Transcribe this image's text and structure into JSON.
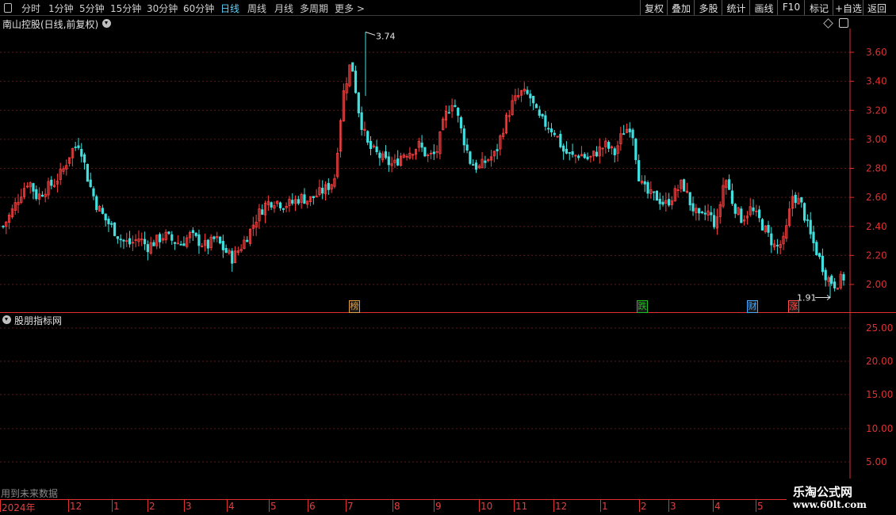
{
  "toolbar": {
    "tabs": [
      "分时",
      "1分钟",
      "5分钟",
      "15分钟",
      "30分钟",
      "60分钟",
      "日线",
      "周线",
      "月线",
      "多周期",
      "更多 >"
    ],
    "active_tab": "日线",
    "right_buttons": [
      "复权",
      "叠加",
      "多股",
      "统计",
      "画线",
      "F10",
      "标记",
      "+自选",
      "返回"
    ]
  },
  "chart": {
    "title": "南山控股(日线,前复权)",
    "high_label": "3.74",
    "low_label": "1.91",
    "tags": [
      {
        "text": "榜",
        "color": "#e0a040"
      },
      {
        "text": "跌",
        "color": "#20c020"
      },
      {
        "text": "财",
        "color": "#4aa8ff"
      },
      {
        "text": "涨",
        "color": "#ff5050"
      }
    ]
  },
  "sub_panel": {
    "title": "股朋指标网",
    "yticks": [
      "25.00",
      "20.00",
      "15.00",
      "10.00",
      "5.00"
    ],
    "future_note": "用到未来数据"
  },
  "watermark": {
    "line1": "乐淘公式网",
    "line2": "www.60lt.com"
  },
  "x_axis": {
    "labels": [
      "2024年",
      "12",
      "1",
      "2",
      "3",
      "4",
      "5",
      "6",
      "7",
      "8",
      "9",
      "10",
      "11",
      "12",
      "1",
      "2",
      "3",
      "4",
      "5"
    ]
  },
  "colors": {
    "up": "#ff4040",
    "down": "#40e0e0",
    "axis": "#e03030",
    "grid": "#5a1a1a"
  },
  "chart_data": {
    "type": "candlestick",
    "title": "南山控股(日线,前复权)",
    "y_ticks": [
      2.0,
      2.2,
      2.4,
      2.6,
      2.8,
      3.0,
      3.2,
      3.4,
      3.6
    ],
    "ylim": [
      1.85,
      3.78
    ],
    "max": 3.74,
    "min": 1.91,
    "close_path": [
      2.4,
      2.5,
      2.62,
      2.72,
      2.6,
      2.66,
      2.7,
      2.78,
      2.92,
      2.98,
      2.72,
      2.55,
      2.45,
      2.38,
      2.3,
      2.28,
      2.32,
      2.26,
      2.3,
      2.34,
      2.3,
      2.28,
      2.34,
      2.3,
      2.26,
      2.32,
      2.24,
      2.18,
      2.26,
      2.36,
      2.48,
      2.56,
      2.58,
      2.55,
      2.56,
      2.6,
      2.58,
      2.62,
      2.66,
      2.72,
      3.3,
      3.55,
      3.15,
      2.95,
      2.9,
      2.85,
      2.82,
      2.9,
      2.92,
      2.96,
      2.88,
      2.9,
      3.15,
      3.28,
      3.05,
      2.85,
      2.8,
      2.86,
      2.9,
      3.1,
      3.25,
      3.32,
      3.3,
      3.15,
      3.1,
      3.05,
      2.92,
      2.88,
      2.9,
      2.86,
      2.92,
      2.96,
      2.9,
      3.05,
      3.1,
      2.7,
      2.62,
      2.6,
      2.55,
      2.62,
      2.7,
      2.55,
      2.45,
      2.5,
      2.4,
      2.75,
      2.55,
      2.45,
      2.52,
      2.45,
      2.35,
      2.25,
      2.3,
      2.62,
      2.55,
      2.35,
      2.2,
      2.05,
      2.0,
      2.05
    ]
  }
}
